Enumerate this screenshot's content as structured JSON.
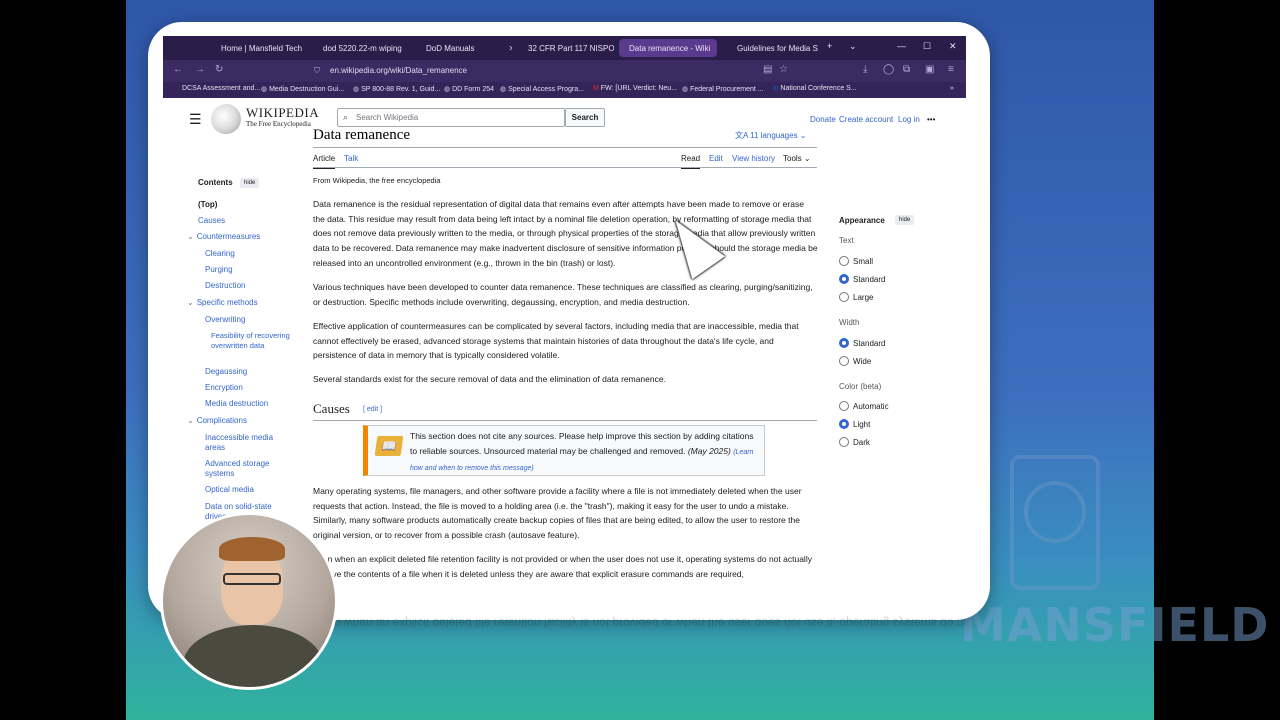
{
  "browser": {
    "tabs": [
      {
        "label": "Home | Mansfield Tech"
      },
      {
        "label": "dod 5220.22-m wiping"
      },
      {
        "label": "DoD Manuals"
      },
      {
        "label": "32 CFR Part 117 NISPO"
      },
      {
        "label": "Data remanence - Wiki"
      },
      {
        "label": "Guidelines for Media S"
      }
    ],
    "url": "en.wikipedia.org/wiki/Data_remanence",
    "bookmarks": [
      "DCSA Assessment and...",
      "Media Destruction Gui...",
      "SP 800-88 Rev. 1, Guid...",
      "DD Form 254",
      "Special Access Progra...",
      "FW: [URL Verdict: Neu...",
      "Federal Procurement ...",
      "National Conference S..."
    ]
  },
  "wiki": {
    "name": "WIKIPEDIA",
    "tagline": "The Free Encyclopedia",
    "search_placeholder": "Search Wikipedia",
    "search_button": "Search",
    "donate": "Donate",
    "create_account": "Create account",
    "login": "Log in",
    "more": "•••"
  },
  "toc": {
    "title": "Contents",
    "hide": "hide",
    "items": [
      "(Top)",
      "Causes",
      "Countermeasures",
      "Clearing",
      "Purging",
      "Destruction",
      "Specific methods",
      "Overwriting",
      "Feasibility of recovering overwritten data",
      "Degaussing",
      "Encryption",
      "Media destruction",
      "Complications",
      "Inaccessible media areas",
      "Advanced storage systems",
      "Optical media",
      "Data on solid-state drives"
    ]
  },
  "article": {
    "title": "Data remanence",
    "languages": "11 languages",
    "tab_article": "Article",
    "tab_talk": "Talk",
    "read": "Read",
    "edit": "Edit",
    "view_history": "View history",
    "tools": "Tools",
    "from": "From Wikipedia, the free encyclopedia",
    "p1": "Data remanence is the residual representation of digital data that remains even after attempts have been made to remove or erase the data. This residue may result from data being left intact by a nominal file deletion operation, by reformatting of storage media that does not remove data previously written to the media, or through physical properties of the storage media that allow previously written data to be recovered. Data remanence may make inadvertent disclosure of sensitive information possible should the storage media be released into an uncontrolled environment (e.g., thrown in the bin (trash) or lost).",
    "p2": "Various techniques have been developed to counter data remanence. These techniques are classified as clearing, purging/sanitizing, or destruction. Specific methods include overwriting, degaussing, encryption, and media destruction.",
    "p3": "Effective application of countermeasures can be complicated by several factors, including media that are inaccessible, media that cannot effectively be erased, advanced storage systems that maintain histories of data throughout the data's life cycle, and persistence of data in memory that is typically considered volatile.",
    "p4": "Several standards exist for the secure removal of data and the elimination of data remanence.",
    "causes": "Causes",
    "edit_bracket": "[ edit ]",
    "notice": "This section does not cite any sources. Please help improve this section by adding citations to reliable sources. Unsourced material may be challenged and removed.",
    "notice_date": "(May 2025)",
    "notice_link": "(Learn how and when to remove this message)",
    "p5": "Many operating systems, file managers, and other software provide a facility where a file is not immediately deleted when the user requests that action. Instead, the file is moved to a holding area (i.e. the \"trash\"), making it easy for the user to undo a mistake. Similarly, many software products automatically create backup copies of files that are being edited, to allow the user to restore the original version, or to recover from a possible crash (autosave feature).",
    "p6": "Even when an explicit deleted file retention facility is not provided or when the user does not use it, operating systems do not actually remove the contents of a file when it is deleted unless they are aware that explicit erasure commands are required,"
  },
  "appearance": {
    "title": "Appearance",
    "hide": "hide",
    "text_label": "Text",
    "text_options": [
      "Small",
      "Standard",
      "Large"
    ],
    "text_selected": "Standard",
    "width_label": "Width",
    "width_options": [
      "Standard",
      "Wide"
    ],
    "width_selected": "Standard",
    "color_label": "Color (beta)",
    "color_options": [
      "Automatic",
      "Light",
      "Dark"
    ],
    "color_selected": "Light"
  },
  "watermark": {
    "brand": "MANSFIELD"
  }
}
